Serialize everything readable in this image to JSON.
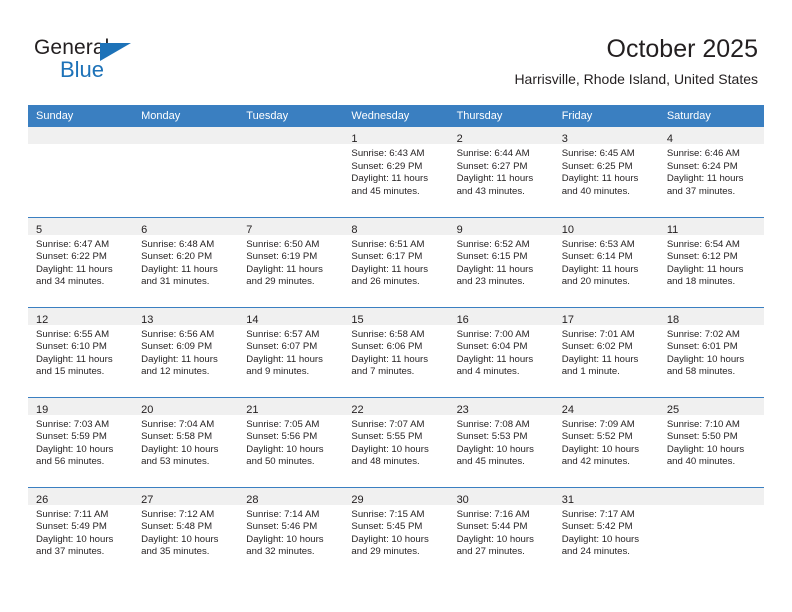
{
  "brand": {
    "name_top": "General",
    "name_bottom": "Blue",
    "triangle_icon": "blue-triangle-icon",
    "accent_color": "#1d72b8"
  },
  "header": {
    "title": "October 2025",
    "subtitle": "Harrisville, Rhode Island, United States"
  },
  "theme": {
    "header_row_bg": "#3a7fc1",
    "daynum_strip_bg": "#f0f0f0",
    "week_divider": "#3a7fc1",
    "text": "#231f20"
  },
  "weekday_headers": [
    "Sunday",
    "Monday",
    "Tuesday",
    "Wednesday",
    "Thursday",
    "Friday",
    "Saturday"
  ],
  "weeks": [
    [
      {
        "day": "",
        "sunrise": "",
        "sunset": "",
        "daylight": "",
        "empty": true
      },
      {
        "day": "",
        "sunrise": "",
        "sunset": "",
        "daylight": "",
        "empty": true
      },
      {
        "day": "",
        "sunrise": "",
        "sunset": "",
        "daylight": "",
        "empty": true
      },
      {
        "day": "1",
        "sunrise": "Sunrise: 6:43 AM",
        "sunset": "Sunset: 6:29 PM",
        "daylight": "Daylight: 11 hours and 45 minutes."
      },
      {
        "day": "2",
        "sunrise": "Sunrise: 6:44 AM",
        "sunset": "Sunset: 6:27 PM",
        "daylight": "Daylight: 11 hours and 43 minutes."
      },
      {
        "day": "3",
        "sunrise": "Sunrise: 6:45 AM",
        "sunset": "Sunset: 6:25 PM",
        "daylight": "Daylight: 11 hours and 40 minutes."
      },
      {
        "day": "4",
        "sunrise": "Sunrise: 6:46 AM",
        "sunset": "Sunset: 6:24 PM",
        "daylight": "Daylight: 11 hours and 37 minutes."
      }
    ],
    [
      {
        "day": "5",
        "sunrise": "Sunrise: 6:47 AM",
        "sunset": "Sunset: 6:22 PM",
        "daylight": "Daylight: 11 hours and 34 minutes."
      },
      {
        "day": "6",
        "sunrise": "Sunrise: 6:48 AM",
        "sunset": "Sunset: 6:20 PM",
        "daylight": "Daylight: 11 hours and 31 minutes."
      },
      {
        "day": "7",
        "sunrise": "Sunrise: 6:50 AM",
        "sunset": "Sunset: 6:19 PM",
        "daylight": "Daylight: 11 hours and 29 minutes."
      },
      {
        "day": "8",
        "sunrise": "Sunrise: 6:51 AM",
        "sunset": "Sunset: 6:17 PM",
        "daylight": "Daylight: 11 hours and 26 minutes."
      },
      {
        "day": "9",
        "sunrise": "Sunrise: 6:52 AM",
        "sunset": "Sunset: 6:15 PM",
        "daylight": "Daylight: 11 hours and 23 minutes."
      },
      {
        "day": "10",
        "sunrise": "Sunrise: 6:53 AM",
        "sunset": "Sunset: 6:14 PM",
        "daylight": "Daylight: 11 hours and 20 minutes."
      },
      {
        "day": "11",
        "sunrise": "Sunrise: 6:54 AM",
        "sunset": "Sunset: 6:12 PM",
        "daylight": "Daylight: 11 hours and 18 minutes."
      }
    ],
    [
      {
        "day": "12",
        "sunrise": "Sunrise: 6:55 AM",
        "sunset": "Sunset: 6:10 PM",
        "daylight": "Daylight: 11 hours and 15 minutes."
      },
      {
        "day": "13",
        "sunrise": "Sunrise: 6:56 AM",
        "sunset": "Sunset: 6:09 PM",
        "daylight": "Daylight: 11 hours and 12 minutes."
      },
      {
        "day": "14",
        "sunrise": "Sunrise: 6:57 AM",
        "sunset": "Sunset: 6:07 PM",
        "daylight": "Daylight: 11 hours and 9 minutes."
      },
      {
        "day": "15",
        "sunrise": "Sunrise: 6:58 AM",
        "sunset": "Sunset: 6:06 PM",
        "daylight": "Daylight: 11 hours and 7 minutes."
      },
      {
        "day": "16",
        "sunrise": "Sunrise: 7:00 AM",
        "sunset": "Sunset: 6:04 PM",
        "daylight": "Daylight: 11 hours and 4 minutes."
      },
      {
        "day": "17",
        "sunrise": "Sunrise: 7:01 AM",
        "sunset": "Sunset: 6:02 PM",
        "daylight": "Daylight: 11 hours and 1 minute."
      },
      {
        "day": "18",
        "sunrise": "Sunrise: 7:02 AM",
        "sunset": "Sunset: 6:01 PM",
        "daylight": "Daylight: 10 hours and 58 minutes."
      }
    ],
    [
      {
        "day": "19",
        "sunrise": "Sunrise: 7:03 AM",
        "sunset": "Sunset: 5:59 PM",
        "daylight": "Daylight: 10 hours and 56 minutes."
      },
      {
        "day": "20",
        "sunrise": "Sunrise: 7:04 AM",
        "sunset": "Sunset: 5:58 PM",
        "daylight": "Daylight: 10 hours and 53 minutes."
      },
      {
        "day": "21",
        "sunrise": "Sunrise: 7:05 AM",
        "sunset": "Sunset: 5:56 PM",
        "daylight": "Daylight: 10 hours and 50 minutes."
      },
      {
        "day": "22",
        "sunrise": "Sunrise: 7:07 AM",
        "sunset": "Sunset: 5:55 PM",
        "daylight": "Daylight: 10 hours and 48 minutes."
      },
      {
        "day": "23",
        "sunrise": "Sunrise: 7:08 AM",
        "sunset": "Sunset: 5:53 PM",
        "daylight": "Daylight: 10 hours and 45 minutes."
      },
      {
        "day": "24",
        "sunrise": "Sunrise: 7:09 AM",
        "sunset": "Sunset: 5:52 PM",
        "daylight": "Daylight: 10 hours and 42 minutes."
      },
      {
        "day": "25",
        "sunrise": "Sunrise: 7:10 AM",
        "sunset": "Sunset: 5:50 PM",
        "daylight": "Daylight: 10 hours and 40 minutes."
      }
    ],
    [
      {
        "day": "26",
        "sunrise": "Sunrise: 7:11 AM",
        "sunset": "Sunset: 5:49 PM",
        "daylight": "Daylight: 10 hours and 37 minutes."
      },
      {
        "day": "27",
        "sunrise": "Sunrise: 7:12 AM",
        "sunset": "Sunset: 5:48 PM",
        "daylight": "Daylight: 10 hours and 35 minutes."
      },
      {
        "day": "28",
        "sunrise": "Sunrise: 7:14 AM",
        "sunset": "Sunset: 5:46 PM",
        "daylight": "Daylight: 10 hours and 32 minutes."
      },
      {
        "day": "29",
        "sunrise": "Sunrise: 7:15 AM",
        "sunset": "Sunset: 5:45 PM",
        "daylight": "Daylight: 10 hours and 29 minutes."
      },
      {
        "day": "30",
        "sunrise": "Sunrise: 7:16 AM",
        "sunset": "Sunset: 5:44 PM",
        "daylight": "Daylight: 10 hours and 27 minutes."
      },
      {
        "day": "31",
        "sunrise": "Sunrise: 7:17 AM",
        "sunset": "Sunset: 5:42 PM",
        "daylight": "Daylight: 10 hours and 24 minutes."
      },
      {
        "day": "",
        "sunrise": "",
        "sunset": "",
        "daylight": "",
        "empty": true
      }
    ]
  ]
}
